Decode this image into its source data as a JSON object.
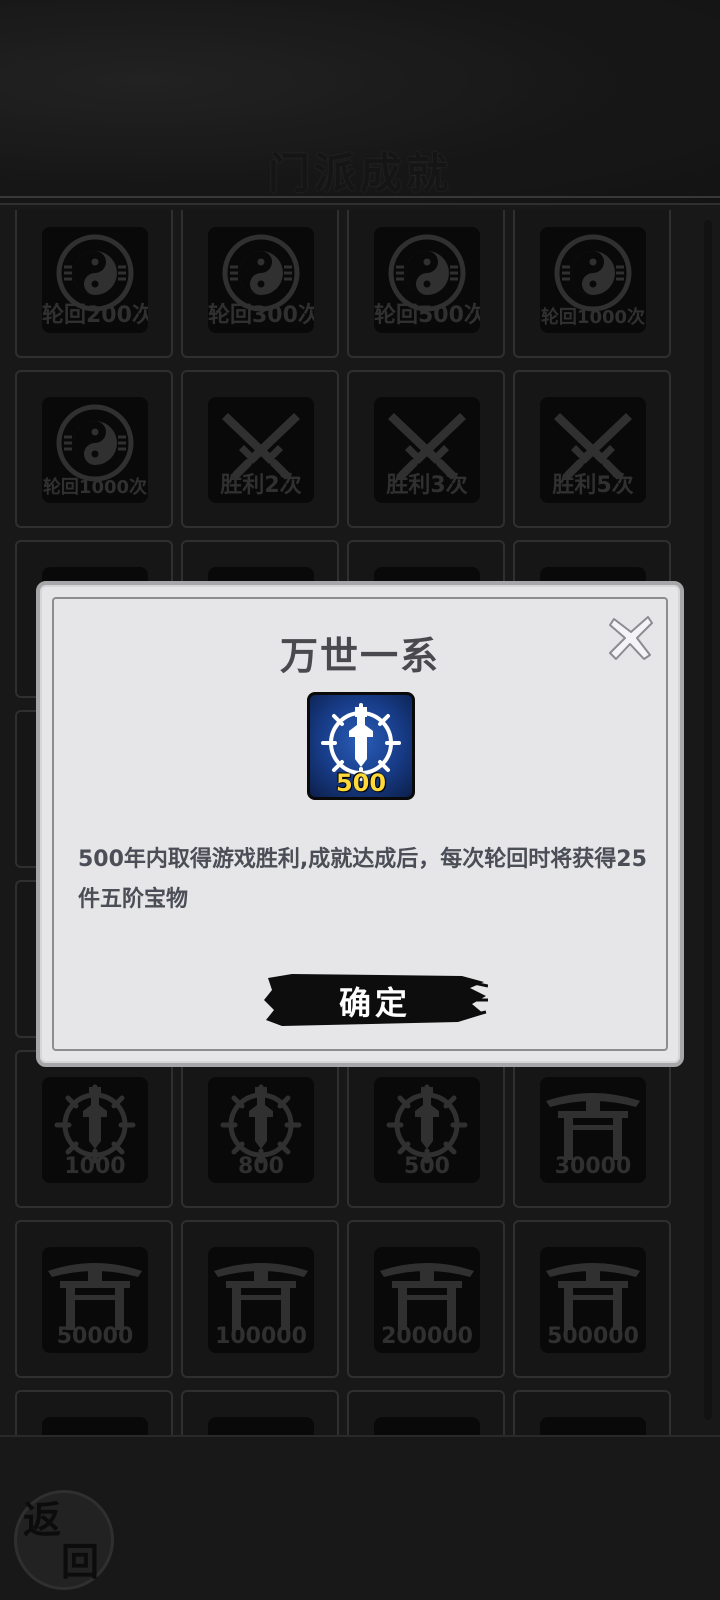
{
  "header": {
    "title": "门派成就"
  },
  "grid": [
    {
      "icon": "yin-yang-icon",
      "label": "轮回200次"
    },
    {
      "icon": "yin-yang-icon",
      "label": "轮回300次"
    },
    {
      "icon": "yin-yang-icon",
      "label": "轮回500次"
    },
    {
      "icon": "yin-yang-icon",
      "label": "轮回1000次"
    },
    {
      "icon": "yin-yang-icon",
      "label": "轮回1000次"
    },
    {
      "icon": "crossed-swords-icon",
      "label": "胜利2次"
    },
    {
      "icon": "crossed-swords-icon",
      "label": "胜利3次"
    },
    {
      "icon": "crossed-swords-icon",
      "label": "胜利5次"
    },
    {
      "icon": "crossed-swords-icon",
      "label": ""
    },
    {
      "icon": "crossed-swords-icon",
      "label": ""
    },
    {
      "icon": "crossed-swords-icon",
      "label": ""
    },
    {
      "icon": "crossed-swords-icon",
      "label": ""
    },
    {
      "icon": "sword-emblem-icon",
      "label": "1000"
    },
    {
      "icon": "sword-emblem-icon",
      "label": "800"
    },
    {
      "icon": "sword-emblem-icon",
      "label": "500"
    },
    {
      "icon": "gate-icon",
      "label": "30000"
    },
    {
      "icon": "gate-icon",
      "label": "50000"
    },
    {
      "icon": "gate-icon",
      "label": "100000"
    },
    {
      "icon": "gate-icon",
      "label": "200000"
    },
    {
      "icon": "gate-icon",
      "label": "500000"
    }
  ],
  "modal": {
    "title": "万世一系",
    "badge_icon": "sword-emblem-icon",
    "badge_number": "500",
    "description": "500年内取得游戏胜利,成就达成后，每次轮回时将获得25件五阶宝物",
    "confirm_label": "确定",
    "close_icon": "close-icon"
  },
  "footer": {
    "back_char_1": "返",
    "back_char_2": "回"
  },
  "colors": {
    "modal_bg": "#e6e6e9",
    "badge_blue": "#173b86",
    "badge_number": "#ffd83a",
    "tile_bg": "#0c0c0c"
  }
}
